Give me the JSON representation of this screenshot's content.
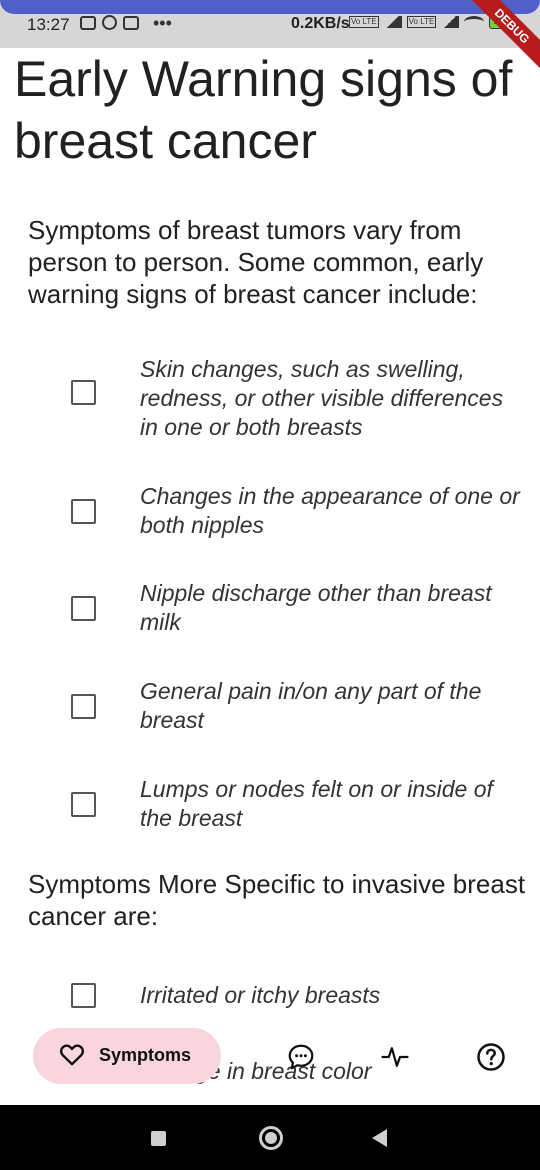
{
  "status_bar": {
    "time": "13:27",
    "net_speed": "0.2KB/s",
    "volte_1": "Vo LTE",
    "volte_2": "Vo LTE",
    "battery": "100",
    "debug_ribbon": "DEBUG"
  },
  "page": {
    "title": "Early Warning signs of breast cancer",
    "intro": "Symptoms of breast tumors vary from person to person. Some common, early warning signs of breast cancer include:",
    "early_signs": [
      {
        "label": "Skin changes, such as swelling, redness, or other visible differences in one or both breasts",
        "checked": false
      },
      {
        "label": "Changes in the appearance of one or both nipples",
        "checked": false
      },
      {
        "label": "Nipple discharge other than breast milk",
        "checked": false
      },
      {
        "label": "General pain in/on any part of the breast",
        "checked": false
      },
      {
        "label": "Lumps or nodes felt on or inside of the breast",
        "checked": false
      }
    ],
    "invasive_heading": "Symptoms More Specific to invasive breast cancer are:",
    "invasive_signs": [
      {
        "label": "Irritated or itchy breasts",
        "checked": false
      },
      {
        "label": "Change in breast color",
        "checked": false
      }
    ]
  },
  "bottom_nav": {
    "active_label": "Symptoms",
    "active_color": "#f9d5dd",
    "items": [
      {
        "icon": "heart-icon"
      },
      {
        "icon": "chat-icon"
      },
      {
        "icon": "pulse-icon"
      },
      {
        "icon": "help-icon"
      }
    ]
  },
  "colors": {
    "status_accent": "#5060c8",
    "status_bg": "#d6d6d6",
    "debug_red": "#b71c1c"
  }
}
